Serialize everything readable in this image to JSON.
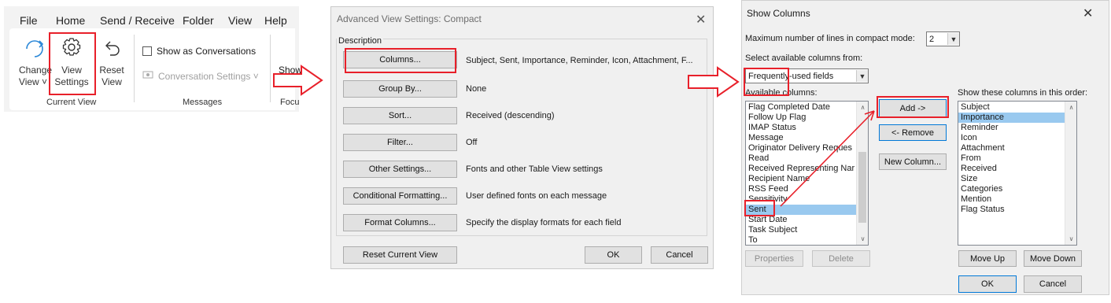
{
  "ribbon": {
    "tabs": [
      "File",
      "Home",
      "Send / Receive",
      "Folder",
      "View",
      "Help"
    ],
    "active_tab": "View",
    "change_view": [
      "Change",
      "View ˅"
    ],
    "view_settings": [
      "View",
      "Settings"
    ],
    "reset_view": [
      "Reset",
      "View"
    ],
    "current_view_group": "Current View",
    "show_as_conversations": "Show as Conversations",
    "conversation_settings": "Conversation Settings ˅",
    "messages_group": "Messages",
    "truncated_top": "Show",
    "truncated_mid": "F",
    "truncated_group": "Focu"
  },
  "dialog1": {
    "title": "Advanced View Settings: Compact",
    "group_label": "Description",
    "rows": [
      {
        "button": "Columns...",
        "desc": "Subject, Sent, Importance, Reminder, Icon, Attachment, F..."
      },
      {
        "button": "Group By...",
        "desc": "None"
      },
      {
        "button": "Sort...",
        "desc": "Received (descending)"
      },
      {
        "button": "Filter...",
        "desc": "Off"
      },
      {
        "button": "Other Settings...",
        "desc": "Fonts and other Table View settings"
      },
      {
        "button": "Conditional Formatting...",
        "desc": "User defined fonts on each message"
      },
      {
        "button": "Format Columns...",
        "desc": "Specify the display formats for each field"
      }
    ],
    "reset": "Reset Current View",
    "ok": "OK",
    "cancel": "Cancel"
  },
  "dialog2": {
    "title": "Show Columns",
    "max_lines_label": "Maximum number of lines in compact mode:",
    "max_lines_value": "2",
    "select_from_label": "Select available columns from:",
    "select_from_value": "Frequently-used fields",
    "available_label": "Available columns:",
    "available_items": [
      "Flag Completed Date",
      "Follow Up Flag",
      "IMAP Status",
      "Message",
      "Originator Delivery Reques",
      "Read",
      "Received Representing Nar",
      "Recipient Name",
      "RSS Feed",
      "Sensitivity",
      "Sent",
      "Start Date",
      "Task Subject",
      "To"
    ],
    "available_selected": "Sent",
    "add": "Add ->",
    "remove": "<- Remove",
    "new_column": "New Column...",
    "order_label": "Show these columns in this order:",
    "order_items": [
      "Subject",
      "Importance",
      "Reminder",
      "Icon",
      "Attachment",
      "From",
      "Received",
      "Size",
      "Categories",
      "Mention",
      "Flag Status"
    ],
    "order_selected": "Importance",
    "properties": "Properties",
    "delete": "Delete",
    "move_up": "Move Up",
    "move_down": "Move Down",
    "ok": "OK",
    "cancel": "Cancel"
  },
  "colors": {
    "annotation": "#e8202a",
    "selection": "#99c9ef",
    "accent": "#0078d7"
  }
}
